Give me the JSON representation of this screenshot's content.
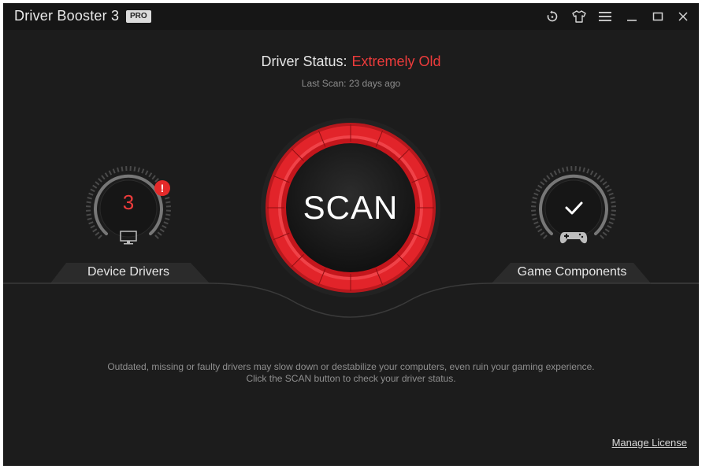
{
  "window": {
    "title": "Driver Booster 3",
    "badge": "PRO"
  },
  "titlebar_icons": [
    "restore-scan-icon",
    "skin-shirt-icon",
    "menu-icon",
    "minimize-icon",
    "maximize-icon",
    "close-icon"
  ],
  "status": {
    "label": "Driver Status:",
    "value": "Extremely Old",
    "value_color": "#ec3b3b",
    "last_scan": "Last Scan: 23 days ago"
  },
  "device_drivers": {
    "count": "3",
    "alert": "!",
    "label": "Device Drivers",
    "icon": "monitor-icon"
  },
  "scan_button": {
    "label": "SCAN",
    "ring_color": "#e2242a"
  },
  "game_components": {
    "label": "Game Components",
    "status_icon": "checkmark-icon",
    "icon": "gamepad-icon"
  },
  "info": {
    "line1": "Outdated, missing or faulty drivers may slow down or destabilize your computers, even ruin your gaming experience.",
    "line2": "Click the SCAN button to check your driver status."
  },
  "footer": {
    "manage_license": "Manage License"
  }
}
